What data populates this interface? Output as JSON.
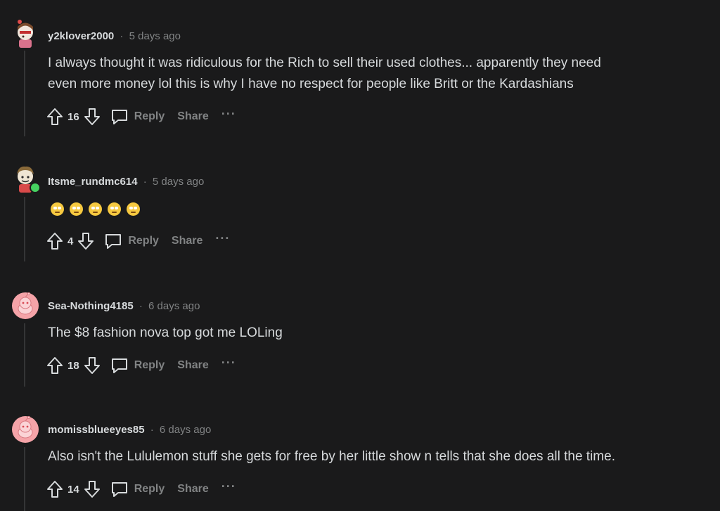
{
  "comments": [
    {
      "username": "y2klover2000",
      "separator": "·",
      "time": "5 days ago",
      "body_line1": "I always thought it was ridiculous for the Rich to sell their used clothes... apparently they need",
      "body_line2": "even more money lol this is why I have no respect for people like Britt or the Kardashians",
      "votes": "16",
      "reply": "Reply",
      "share": "Share",
      "more": "···"
    },
    {
      "username": "Itsme_rundmc614",
      "separator": "·",
      "time": "5 days ago",
      "emojis": [
        "eye-roll-emoji",
        "eye-roll-emoji",
        "eye-roll-emoji",
        "eye-roll-emoji",
        "eye-roll-emoji"
      ],
      "votes": "4",
      "reply": "Reply",
      "share": "Share",
      "more": "···"
    },
    {
      "username": "Sea-Nothing4185",
      "separator": "·",
      "time": "6 days ago",
      "body_line1": "The $8 fashion nova top got me LOLing",
      "votes": "18",
      "reply": "Reply",
      "share": "Share",
      "more": "···"
    },
    {
      "username": "momissblueeyes85",
      "separator": "·",
      "time": "6 days ago",
      "body_line1": "Also isn't the Lululemon stuff she gets for free by her little show n tells that she does all the time.",
      "votes": "14",
      "reply": "Reply",
      "share": "Share",
      "more": "···"
    }
  ],
  "colors": {
    "background": "#1a1a1b",
    "text": "#d7dadc",
    "muted": "#818384",
    "online": "#46d160",
    "default_avatar": "#f5a3a8"
  }
}
